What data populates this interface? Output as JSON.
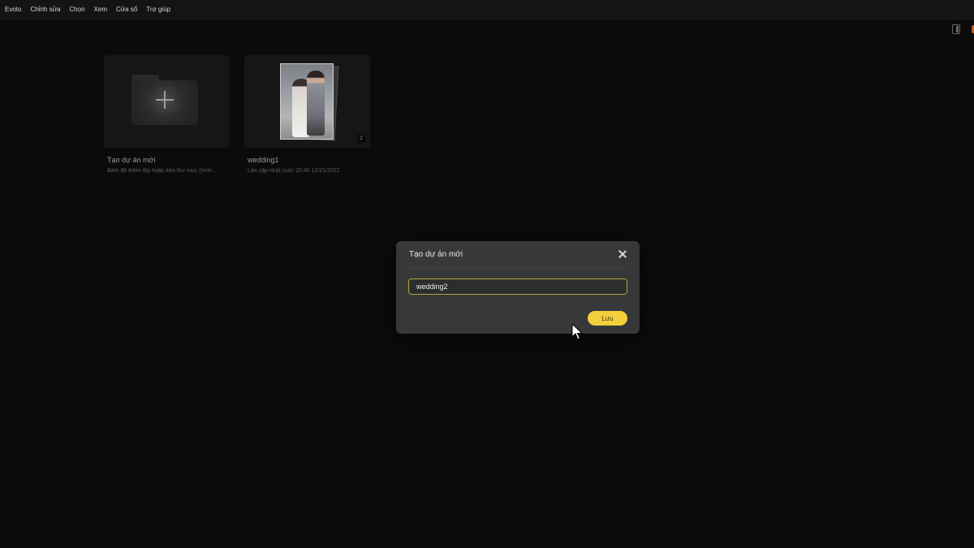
{
  "menubar": {
    "items": [
      "Evoto",
      "Chỉnh sửa",
      "Chọn",
      "Xem",
      "Cửa sổ",
      "Trợ giúp"
    ]
  },
  "projects": {
    "new_project": {
      "title": "Tạo dự án mới",
      "subtitle": "Bấm để thêm tệp hoặc kéo thư mục (hình..."
    },
    "existing": {
      "title": "wedding1",
      "subtitle": "Lần cập nhật cuối: 20:40 12/21/2022",
      "count": "2"
    }
  },
  "dialog": {
    "title": "Tạo dự án mới",
    "input_value": "wedding2",
    "save_label": "Lưu"
  },
  "colors": {
    "accent": "#f2d03b",
    "background": "#0b0b0c",
    "dialog_bg": "#37383a"
  },
  "icons": {
    "close": "close-icon",
    "plus": "plus-icon",
    "panel": "panel-toggle-icon",
    "cursor": "mouse-cursor-icon"
  }
}
